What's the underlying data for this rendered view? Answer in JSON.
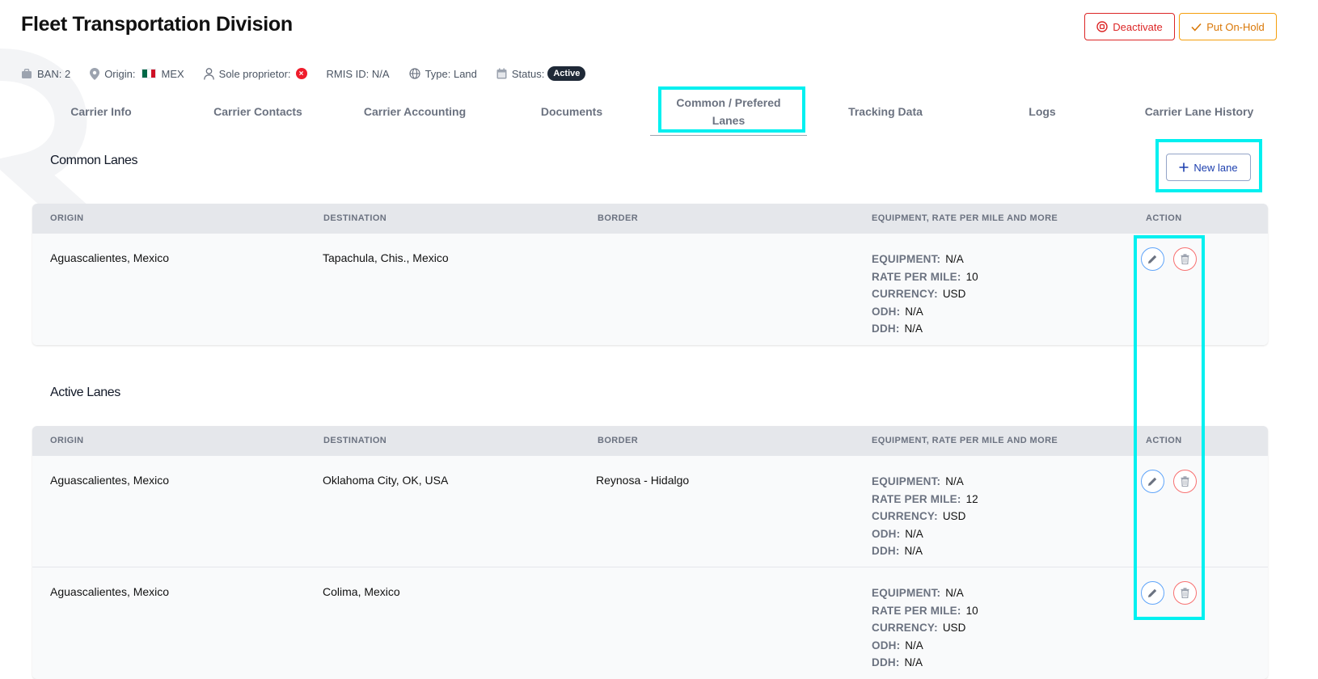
{
  "header": {
    "title": "Fleet Transportation Division",
    "ban": "BAN: 2",
    "origin_label": "Origin:",
    "origin_country": "MEX",
    "sole_proprietor_label": "Sole proprietor:",
    "rmis": "RMIS ID: N/A",
    "type": "Type: Land",
    "status_label": "Status:",
    "status_value": "Active",
    "deactivate_label": "Deactivate",
    "hold_label": "Put On-Hold"
  },
  "tabs": [
    {
      "label": "Carrier Info"
    },
    {
      "label": "Carrier Contacts"
    },
    {
      "label": "Carrier Accounting"
    },
    {
      "label": "Documents"
    },
    {
      "label": "Common / Prefered Lanes"
    },
    {
      "label": "Tracking Data"
    },
    {
      "label": "Logs"
    },
    {
      "label": "Carrier Lane History"
    }
  ],
  "columns": {
    "origin": "ORIGIN",
    "destination": "DESTINATION",
    "border": "BORDER",
    "details": "EQUIPMENT, RATE PER MILE AND MORE",
    "action": "ACTION"
  },
  "detail_labels": {
    "equipment": "EQUIPMENT:",
    "rate": "RATE PER MILE:",
    "currency": "CURRENCY:",
    "odh": "ODH:",
    "ddh": "DDH:"
  },
  "common": {
    "title": "Common Lanes",
    "new_lane_label": "New lane",
    "rows": [
      {
        "origin": "Aguascalientes, Mexico",
        "destination": "Tapachula, Chis., Mexico",
        "border": "",
        "equipment": "N/A",
        "rate": "10",
        "currency": "USD",
        "odh": "N/A",
        "ddh": "N/A"
      }
    ]
  },
  "active": {
    "title": "Active Lanes",
    "rows": [
      {
        "origin": "Aguascalientes, Mexico",
        "destination": "Oklahoma City, OK, USA",
        "border": "Reynosa - Hidalgo",
        "equipment": "N/A",
        "rate": "12",
        "currency": "USD",
        "odh": "N/A",
        "ddh": "N/A"
      },
      {
        "origin": "Aguascalientes, Mexico",
        "destination": "Colima, Mexico",
        "border": "",
        "equipment": "N/A",
        "rate": "10",
        "currency": "USD",
        "odh": "N/A",
        "ddh": "N/A"
      }
    ]
  },
  "colors": {
    "highlight": "#00f0f0",
    "danger": "#dc2626",
    "warning": "#f59e0b",
    "primary": "#1e40af"
  },
  "icons": {
    "ban": "briefcase-icon",
    "origin": "location-pin-icon",
    "sole": "user-icon",
    "type": "globe-icon",
    "status": "calendar-icon",
    "edit": "pencil-icon",
    "delete": "trash-icon"
  }
}
